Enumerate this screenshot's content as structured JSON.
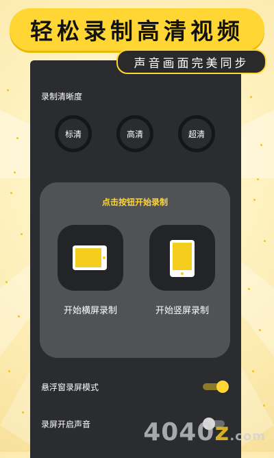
{
  "headline": {
    "title": "轻松录制高清视频",
    "subtitle": "声音画面完美同步"
  },
  "quality": {
    "label": "录制清晰度",
    "options": [
      "标清",
      "高清",
      "超清"
    ]
  },
  "card": {
    "title": "点击按钮开始录制",
    "landscape_label": "开始横屏录制",
    "portrait_label": "开始竖屏录制"
  },
  "settings": {
    "floating_label": "悬浮窗录屏模式",
    "floating_on": true,
    "sound_label": "录屏开启声音",
    "sound_on": false
  },
  "colors": {
    "accent": "#ffd633",
    "panel": "#2a2c30",
    "card": "#505255"
  },
  "watermark": {
    "text_a": "4040",
    "text_b": "z",
    "text_c": ".com"
  }
}
